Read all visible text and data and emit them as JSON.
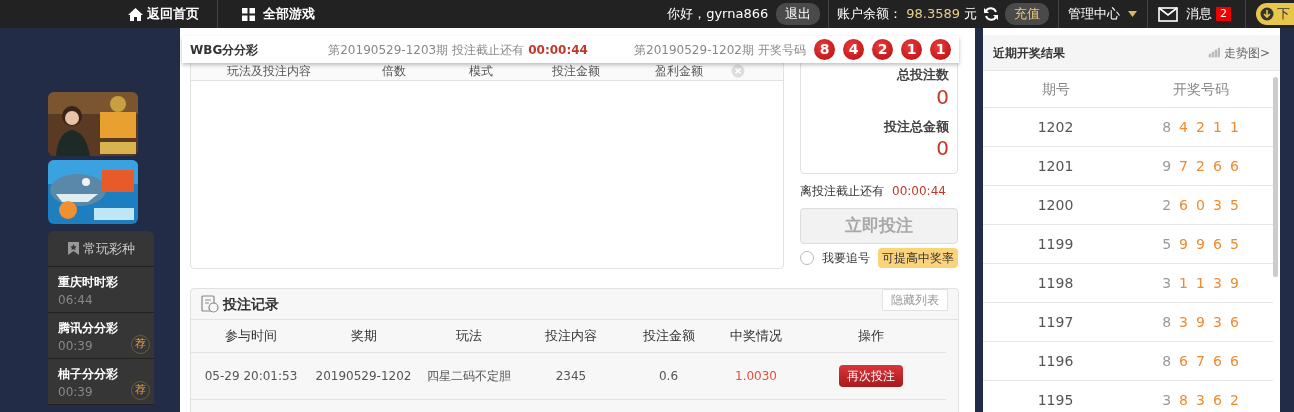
{
  "topbar": {
    "home": "返回首页",
    "all_games": "全部游戏",
    "greeting": "你好，gyrna866",
    "logout": "退出",
    "balance_label": "账户余额：",
    "balance": "98.3589",
    "currency": "元",
    "recharge": "充值",
    "manage": "管理中心",
    "messages": "消息",
    "message_count": "2",
    "download": "下"
  },
  "sidebar": {
    "favorites_title": "常玩彩种",
    "games": [
      {
        "name": "重庆时时彩",
        "time": "06:44"
      },
      {
        "name": "腾讯分分彩",
        "time": "00:39",
        "badge": "荐"
      },
      {
        "name": "柚子分分彩",
        "time": "00:39",
        "badge": "荐"
      }
    ]
  },
  "lottery_bar": {
    "name": "WBG分分彩",
    "current_issue": "第20190529-1203期",
    "deadline_label": "投注截止还有",
    "countdown": "00:00:44",
    "last_issue": "第20190529-1202期",
    "result_label": "开奖号码",
    "balls": [
      "8",
      "4",
      "2",
      "1",
      "1"
    ]
  },
  "bet_list": {
    "columns": [
      "玩法及投注内容",
      "倍数",
      "模式",
      "投注金额",
      "盈利金额"
    ]
  },
  "summary": {
    "total_count_label": "总投注数",
    "total_count": "0",
    "total_amount_label": "投注总金额",
    "total_amount": "0",
    "deadline_label": "离投注截止还有",
    "countdown": "00:00:44",
    "submit": "立即投注",
    "submit_disabled": true,
    "chase_label": "我要追号",
    "chase_checked": false,
    "chase_tip": "可提高中奖率"
  },
  "records": {
    "title": "投注记录",
    "hide_button": "隐藏列表",
    "columns": [
      "参与时间",
      "奖期",
      "玩法",
      "投注内容",
      "投注金额",
      "中奖情况",
      "操作"
    ],
    "rows": [
      {
        "cells": [
          "05-29 20:01:53",
          "20190529-1202",
          "四星二码不定胆",
          "2345",
          "0.6",
          "1.0030"
        ],
        "action": "再次投注"
      }
    ]
  },
  "recent": {
    "title": "近期开奖结果",
    "trend_link": "走势图>",
    "columns": [
      "期号",
      "开奖号码"
    ],
    "rows": [
      {
        "issue": "1202",
        "numbers": [
          "8",
          "4",
          "2",
          "1",
          "1"
        ]
      },
      {
        "issue": "1201",
        "numbers": [
          "9",
          "7",
          "2",
          "6",
          "6"
        ]
      },
      {
        "issue": "1200",
        "numbers": [
          "2",
          "6",
          "0",
          "3",
          "5"
        ]
      },
      {
        "issue": "1199",
        "numbers": [
          "5",
          "9",
          "9",
          "6",
          "5"
        ]
      },
      {
        "issue": "1198",
        "numbers": [
          "3",
          "1",
          "1",
          "3",
          "9"
        ]
      },
      {
        "issue": "1197",
        "numbers": [
          "8",
          "3",
          "9",
          "3",
          "6"
        ]
      },
      {
        "issue": "1196",
        "numbers": [
          "8",
          "6",
          "7",
          "6",
          "6"
        ]
      },
      {
        "issue": "1195",
        "numbers": [
          "3",
          "8",
          "3",
          "6",
          "2"
        ]
      }
    ]
  }
}
